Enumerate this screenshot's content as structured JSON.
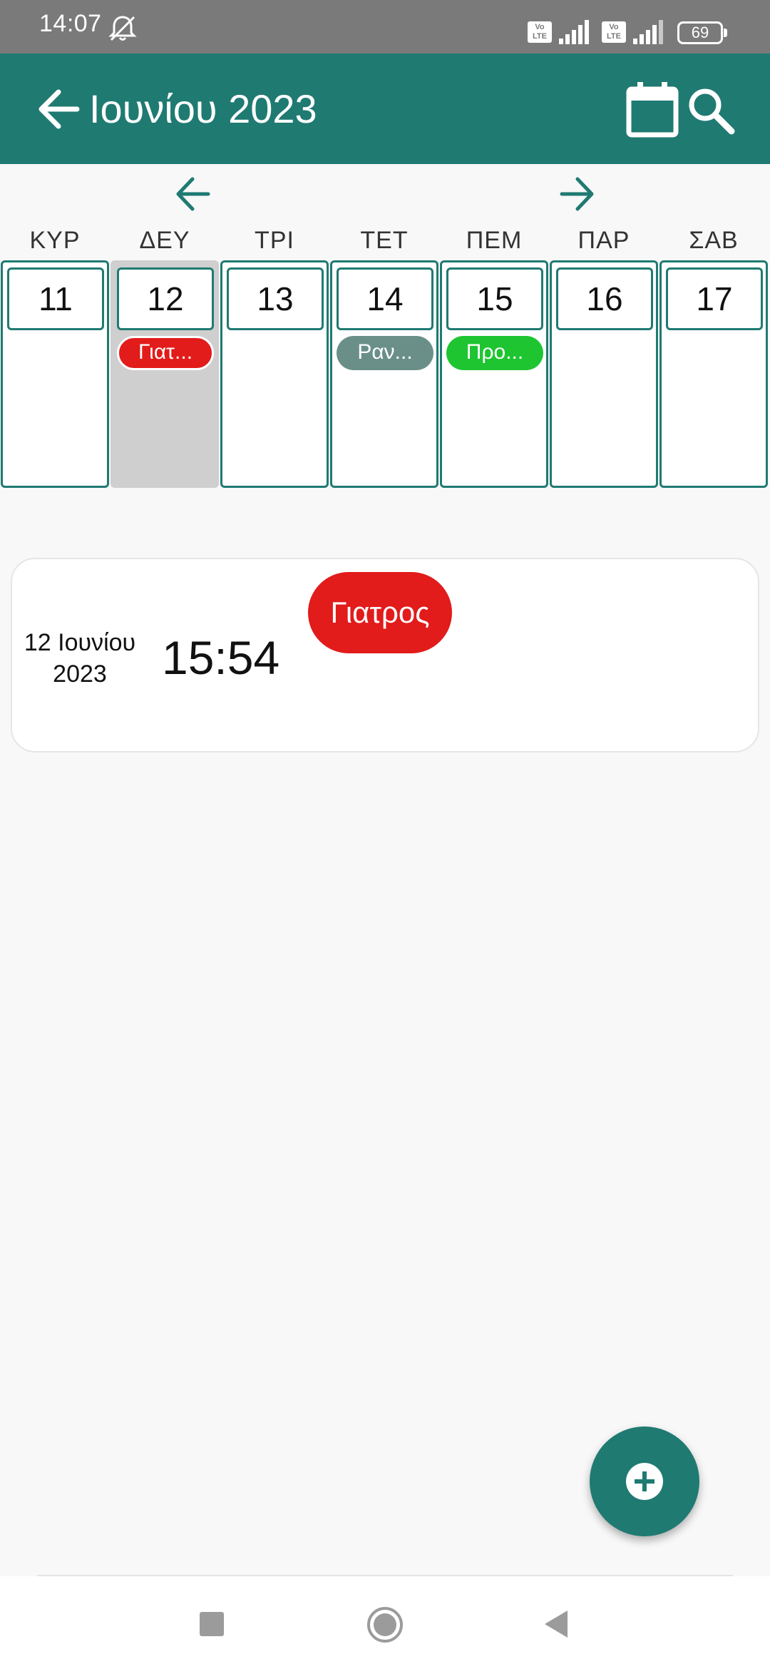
{
  "status_bar": {
    "time": "14:07",
    "volte1": "Vo LTE",
    "volte2": "Vo LTE",
    "battery": "69"
  },
  "app_bar": {
    "title": "Ιουνίου 2023",
    "background": "#1f7a72"
  },
  "week": {
    "days": [
      {
        "name": "ΚΥΡ",
        "number": "11",
        "event": null
      },
      {
        "name": "ΔΕΥ",
        "number": "12",
        "event": {
          "label": "Γιατ...",
          "color": "#e21b1b"
        },
        "selected": true
      },
      {
        "name": "ΤΡΙ",
        "number": "13",
        "event": null
      },
      {
        "name": "ΤΕΤ",
        "number": "14",
        "event": {
          "label": "Ραν...",
          "color": "#6a8f89"
        }
      },
      {
        "name": "ΠΕΜ",
        "number": "15",
        "event": {
          "label": "Προ...",
          "color": "#1ec531"
        }
      },
      {
        "name": "ΠΑΡ",
        "number": "16",
        "event": null
      },
      {
        "name": "ΣΑΒ",
        "number": "17",
        "event": null
      }
    ]
  },
  "event_card": {
    "date_line1": "12 Ιουνίου",
    "date_line2": "2023",
    "time": "15:54",
    "tag": "Γιατρος",
    "tag_color": "#e21b1b"
  }
}
